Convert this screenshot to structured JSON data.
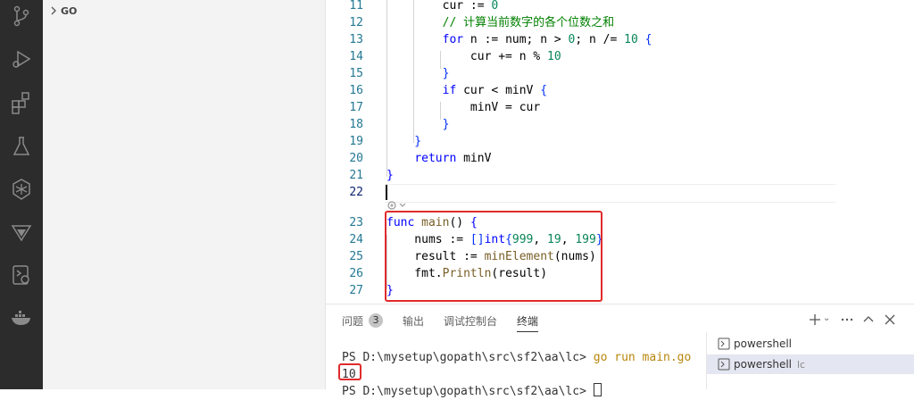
{
  "sidebar": {
    "section_title": "GO"
  },
  "activity_bar": {
    "icons": [
      "source-control-icon",
      "run-debug-icon",
      "extensions-icon",
      "testing-icon",
      "kubernetes-icon",
      "triangle-icon",
      "remote-explorer-icon",
      "docker-icon"
    ]
  },
  "editor": {
    "lines": [
      {
        "num": "11",
        "text": "        cur := 0"
      },
      {
        "num": "12",
        "text": "        // 计算当前数字的各个位数之和"
      },
      {
        "num": "13",
        "text": "        for n := num; n > 0; n /= 10 {"
      },
      {
        "num": "14",
        "text": "            cur += n % 10"
      },
      {
        "num": "15",
        "text": "        }"
      },
      {
        "num": "16",
        "text": "        if cur < minV {"
      },
      {
        "num": "17",
        "text": "            minV = cur"
      },
      {
        "num": "18",
        "text": "        }"
      },
      {
        "num": "19",
        "text": "    }"
      },
      {
        "num": "20",
        "text": "    return minV"
      },
      {
        "num": "21",
        "text": "}"
      },
      {
        "num": "22",
        "text": ""
      },
      {
        "num": "23",
        "text": "func main() {"
      },
      {
        "num": "24",
        "text": "    nums := []int{999, 19, 199}"
      },
      {
        "num": "25",
        "text": "    result := minElement(nums)"
      },
      {
        "num": "26",
        "text": "    fmt.Println(result)"
      },
      {
        "num": "27",
        "text": "}"
      }
    ]
  },
  "panel": {
    "tabs": [
      {
        "label": "问题",
        "badge": "3"
      },
      {
        "label": "输出"
      },
      {
        "label": "调试控制台"
      },
      {
        "label": "终端",
        "active": true
      }
    ],
    "terminal": {
      "line1_prompt": "PS D:\\mysetup\\gopath\\src\\sf2\\aa\\lc> ",
      "line1_cmd": "go run main.go",
      "output": "10",
      "line3_prompt": "PS D:\\mysetup\\gopath\\src\\sf2\\aa\\lc> "
    },
    "terminal_list": [
      {
        "label": "powershell",
        "sub": ""
      },
      {
        "label": "powershell",
        "sub": "lc"
      }
    ]
  },
  "colors": {
    "highlight": "#e02b2b",
    "activity_bar": "#2c2c2c"
  }
}
